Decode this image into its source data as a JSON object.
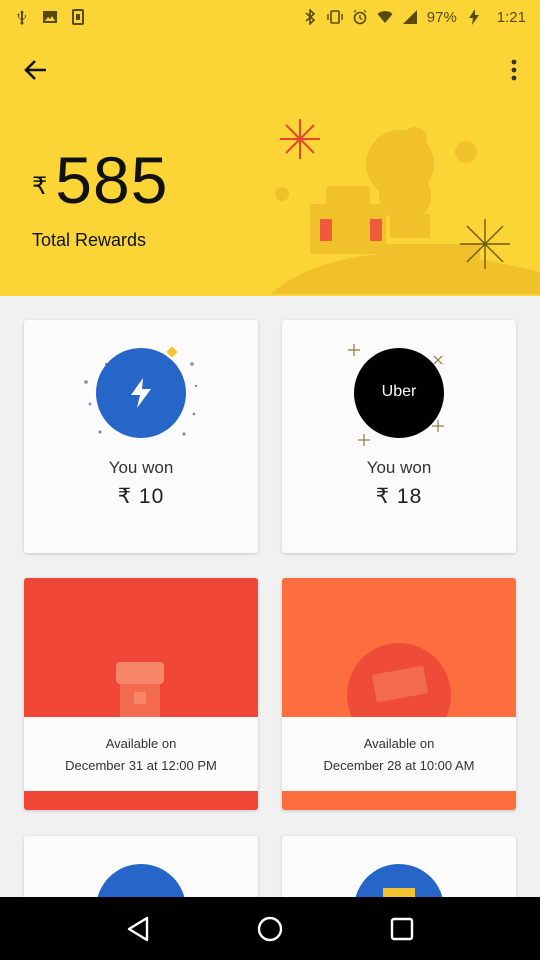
{
  "status_bar": {
    "battery": "97%",
    "time": "1:21",
    "left_icons": [
      "usb-icon",
      "image-icon",
      "phone-cast-icon"
    ],
    "right_icons": [
      "bluetooth-icon",
      "vibrate-icon",
      "alarm-icon",
      "wifi-icon",
      "signal-icon",
      "charging-icon"
    ]
  },
  "header": {
    "currency_symbol": "₹",
    "total_amount": "585",
    "total_label": "Total Rewards",
    "background_color": "#fbd535"
  },
  "rewards": [
    {
      "type": "won",
      "icon": "lightning-icon",
      "circle_color": "#2766c9",
      "title": "You won",
      "amount": "₹ 10"
    },
    {
      "type": "won",
      "logo_text": "Uber",
      "circle_color": "#000000",
      "title": "You won",
      "amount": "₹ 18"
    },
    {
      "type": "locked",
      "color": "#ef4638",
      "available_label": "Available on",
      "available_date": "December 31 at 12:00 PM"
    },
    {
      "type": "locked",
      "color": "#fd6e3f",
      "available_label": "Available on",
      "available_date": "December 28 at 10:00 AM"
    },
    {
      "type": "partial",
      "circle_color": "#2766c9"
    },
    {
      "type": "partial",
      "circle_color": "#2766c9"
    }
  ],
  "nav_bar": {
    "buttons": [
      "back-triangle-icon",
      "home-circle-icon",
      "recents-square-icon"
    ]
  }
}
